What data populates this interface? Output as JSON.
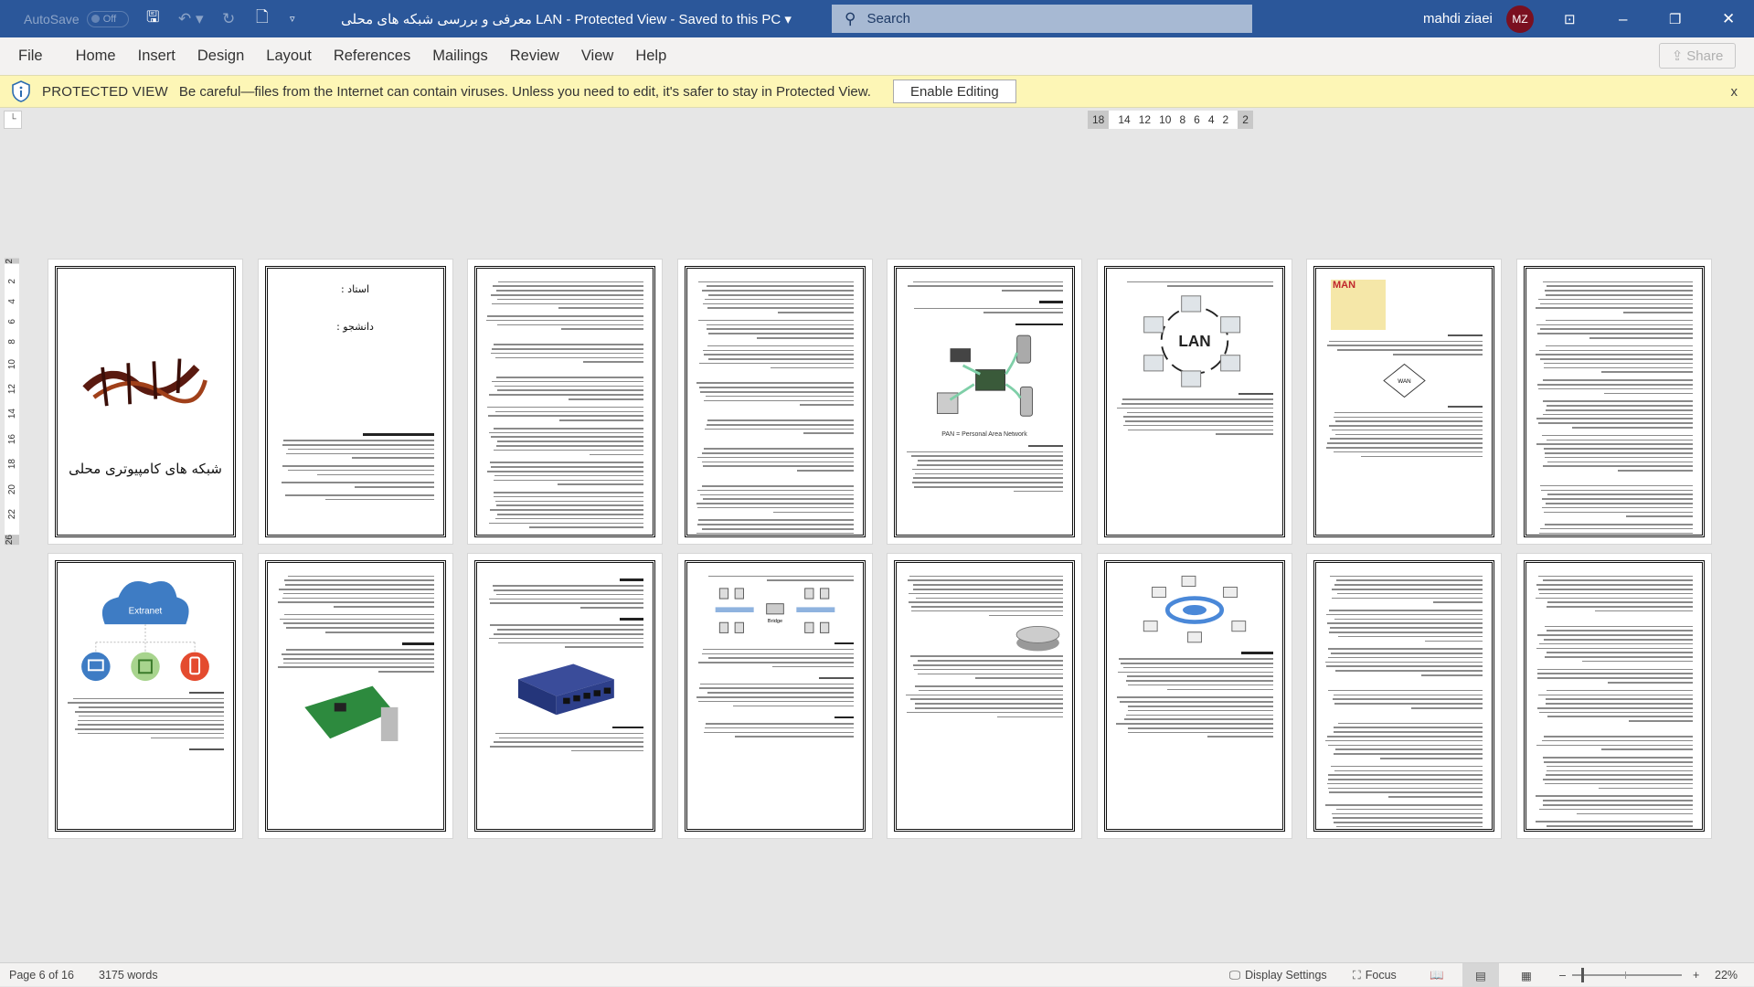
{
  "titlebar": {
    "autosave_label": "AutoSave",
    "autosave_state": "Off",
    "document_title": "معرفی و بررسی شبکه های محلی LAN  -  Protected View  -  Saved to this PC",
    "search_placeholder": "Search",
    "user_name": "mahdi ziaei",
    "user_initials": "MZ"
  },
  "ribbon": {
    "tabs": [
      "File",
      "Home",
      "Insert",
      "Design",
      "Layout",
      "References",
      "Mailings",
      "Review",
      "View",
      "Help"
    ],
    "share_label": "Share"
  },
  "protected_view": {
    "label": "PROTECTED VIEW",
    "message": "Be careful—files from the Internet can contain viruses. Unless you need to edit, it's safer to stay in Protected View.",
    "enable_button": "Enable Editing",
    "close": "x"
  },
  "ruler": {
    "left": "18",
    "numbers": [
      "14",
      "12",
      "10",
      "8",
      "6",
      "4",
      "2"
    ],
    "right": "2",
    "vertical": [
      "2",
      "2",
      "4",
      "6",
      "8",
      "10",
      "12",
      "14",
      "16",
      "18",
      "20",
      "22",
      "26"
    ]
  },
  "pages": {
    "p1": {
      "logo_text": "بسم الله الرحمن الرحیم",
      "title": "شبکه های کامپیوتری محلی"
    },
    "p2": {
      "teacher": "استاد :",
      "student": "دانشجو :"
    },
    "p5": {
      "caption": "PAN = Personal Area Network"
    },
    "p6": {
      "image_label": "LAN"
    },
    "p7": {
      "image_label": "MAN",
      "wan_label": "WAN"
    },
    "p9": {
      "image_label": "Extranet"
    },
    "p12": {
      "image_label": "Bridge"
    }
  },
  "status": {
    "page": "Page 6 of 16",
    "words": "3175 words",
    "display_settings": "Display Settings",
    "focus": "Focus",
    "zoom": "22%"
  },
  "colors": {
    "titlebar": "#2b579a",
    "protected_bar": "#fdf6b6",
    "avatar": "#7a1020",
    "extranet_cloud": "#3e7cc4"
  }
}
